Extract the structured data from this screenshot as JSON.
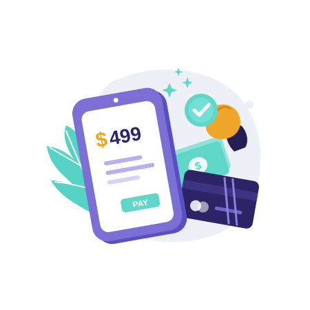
{
  "phone": {
    "currency_symbol": "$",
    "amount": "499",
    "pay_label": "PAY"
  },
  "icons": [
    "leaf-icon",
    "banknotes-icon",
    "credit-card-icon",
    "hand-icon",
    "checkmark-icon",
    "sparkle-icon"
  ],
  "colors": {
    "phone_frame": "#7b6fd6",
    "phone_screen": "#ffffff",
    "amount_text": "#2a2470",
    "currency_symbol": "#f2a61b",
    "pay_button": "#5fd6c8",
    "pay_text": "#ffffff",
    "text_lines": "#b8b0ee",
    "leaf": "#57d3c5",
    "card": "#2c2466",
    "hand": "#f0a62a",
    "sleeve": "#241e55",
    "check_badge": "#5fd6c8",
    "sparkle": "#5fd6c8"
  }
}
